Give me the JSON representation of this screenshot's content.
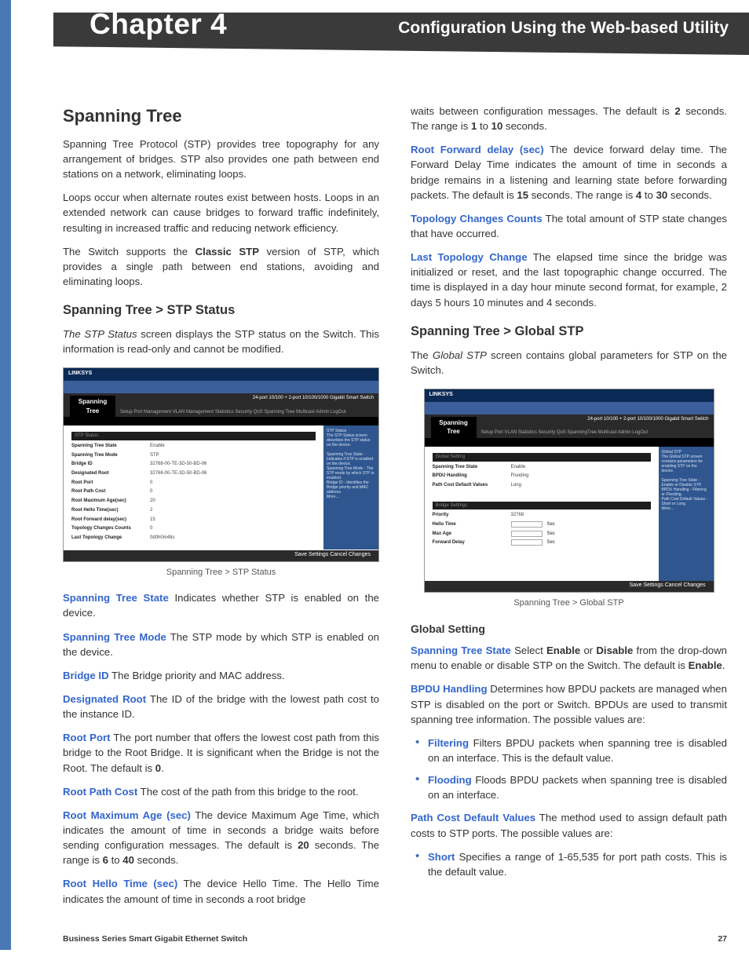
{
  "header": {
    "chapter": "Chapter 4",
    "title": "Configuration Using the Web-based Utility"
  },
  "col1": {
    "h_spanning": "Spanning Tree",
    "p1": "Spanning Tree Protocol (STP) provides tree topography for any arrangement of bridges. STP also provides one path between end stations on a network, eliminating loops.",
    "p2": "Loops occur when alternate routes exist between hosts. Loops in an extended network can cause bridges to forward traffic indefinitely, resulting in increased traffic and reducing network efficiency.",
    "p3a": "The Switch supports the ",
    "p3bold": "Classic STP",
    "p3b": " version of STP, which provides a single path between end stations, avoiding and eliminating loops.",
    "h_stpstatus": "Spanning Tree > STP Status",
    "p4": "The STP Status screen displays the STP status on the Switch. This information is read-only and cannot be modified.",
    "fig1": {
      "brand": "LINKSYS",
      "prod": "24-port 10/100 + 2-port 10/100/1000 Gigabit Smart Switch",
      "sidetab": "Spanning\nTree",
      "tabs": "Setup   Port Management   VLAN Management   Statistics   Security   QoS   Spanning Tree   Multicast   Admin   LogOut",
      "rows": [
        {
          "k": "Spanning Tree State",
          "v": "Enable"
        },
        {
          "k": "Spanning Tree Mode",
          "v": "STP"
        },
        {
          "k": "Bridge ID",
          "v": "32768-00-TE-3D-50-BD-06"
        },
        {
          "k": "Designated Root",
          "v": "32768-00-TE-3D-50-BD-06"
        },
        {
          "k": "Root Port",
          "v": "0"
        },
        {
          "k": "Root Path Cost",
          "v": "0"
        },
        {
          "k": "Root Maximum Age(sec)",
          "v": "20"
        },
        {
          "k": "Root Hello Time(sec)",
          "v": "2"
        },
        {
          "k": "Root Forward delay(sec)",
          "v": "15"
        },
        {
          "k": "Topology Changes Counts",
          "v": "0"
        },
        {
          "k": "Last Topology Change",
          "v": "0d0h0m48s"
        }
      ],
      "footer": "Save Settings  Cancel Changes"
    },
    "figcap1": "Spanning Tree > STP Status",
    "defs": [
      {
        "term": "Spanning Tree State",
        "text": "  Indicates whether STP is enabled on the device."
      },
      {
        "term": "Spanning Tree Mode",
        "text": "  The STP mode by which STP is enabled on the device."
      },
      {
        "term": "Bridge ID",
        "text": "  The Bridge priority and MAC address."
      },
      {
        "term": "Designated Root",
        "text": "  The ID of the bridge with the lowest path cost to the instance ID."
      },
      {
        "term": "Root Port",
        "text": "  The port number that offers the lowest cost path from this bridge to the Root Bridge. It is significant when the Bridge is not the Root. The default is "
      },
      {
        "term": "Root Path Cost",
        "text": "  The cost of the path from this bridge to the root."
      },
      {
        "term": "Root Maximum Age (sec)",
        "text": "  The device Maximum Age Time, which indicates the amount of time in seconds a bridge waits before sending configuration messages. The default is "
      },
      {
        "term": "Root Hello Time (sec)",
        "text": "  The device Hello Time. The Hello Time indicates the amount of time in seconds a root bridge"
      }
    ],
    "rootport_bold": "0",
    "rootmax_bold1": "20",
    "rootmax_mid": " seconds. The range is ",
    "rootmax_bold2": "6",
    "rootmax_to": " to ",
    "rootmax_bold3": "40",
    "rootmax_end": " seconds."
  },
  "col2": {
    "cont_a": "waits between configuration messages. The default is ",
    "cont_b1": "2",
    "cont_mid": " seconds. The range is ",
    "cont_b2": "1",
    "cont_to": " to ",
    "cont_b3": "10",
    "cont_end": " seconds.",
    "defs": [
      {
        "term": "Root Forward delay (sec)",
        "tail_a": "  The device forward delay time. The Forward Delay Time indicates the amount of time in seconds a bridge remains in a listening and learning state before forwarding packets. The default is ",
        "b1": "15",
        "mid": " seconds. The range is ",
        "b2": "4",
        "to": " to ",
        "b3": "30",
        "end": " seconds."
      },
      {
        "term": "Topology Changes Counts",
        "text": "  The total amount of STP state changes that have occurred."
      },
      {
        "term": "Last Topology Change",
        "text": "  The elapsed time since the bridge was initialized or reset, and the last topographic change occurred. The time is displayed in a day hour minute second format, for example, 2 days 5 hours 10 minutes and 4 seconds."
      }
    ],
    "h_global": "Spanning Tree > Global STP",
    "p_global": "The Global STP screen contains global parameters for STP on the Switch.",
    "fig2": {
      "brand": "LINKSYS",
      "sidetab": "Spanning\nTree",
      "sublabels": [
        "Global Setting",
        "Bridge Settings"
      ],
      "rows1": [
        {
          "k": "Spanning Tree State",
          "v": "Enable"
        },
        {
          "k": "BPDU Handling",
          "v": "Flooding"
        },
        {
          "k": "Path Cost Default Values",
          "v": "Long"
        }
      ],
      "rows2": [
        {
          "k": "Priority",
          "v": "32768"
        },
        {
          "k": "Hello Time",
          "v": "",
          "unit": "Sec"
        },
        {
          "k": "Max Age",
          "v": "",
          "unit": "Sec"
        },
        {
          "k": "Forward Delay",
          "v": "",
          "unit": "Sec"
        }
      ],
      "footer": "Save Settings  Cancel Changes"
    },
    "figcap2": "Spanning Tree > Global STP",
    "h4_gs": "Global Setting",
    "gs_sts_term": "Spanning Tree State",
    "gs_sts_a": "  Select ",
    "gs_sts_b1": "Enable",
    "gs_sts_or": " or ",
    "gs_sts_b2": "Disable",
    "gs_sts_mid": " from the drop-down menu to enable or disable STP on the Switch. The default is ",
    "gs_sts_b3": "Enable",
    "gs_bpdu_term": "BPDU Handling",
    "gs_bpdu_text": "  Determines how BPDU packets are managed when STP is disabled on the port or Switch. BPDUs are used to transmit spanning tree information. The possible values are:",
    "bpdu_items": [
      {
        "term": "Filtering",
        "text": "  Filters BPDU packets when spanning tree is disabled on an interface. This is the default value."
      },
      {
        "term": "Flooding",
        "text": "  Floods BPDU packets when spanning tree is disabled on an interface."
      }
    ],
    "pc_term": "Path Cost Default Values",
    "pc_text": "  The method used to assign default path costs to STP ports. The possible values are:",
    "pc_items": [
      {
        "term": "Short",
        "text": "  Specifies a range of 1-65,535 for port path costs. This is the default value."
      }
    ]
  },
  "footer": {
    "left": "Business Series Smart Gigabit Ethernet Switch",
    "page": "27"
  }
}
